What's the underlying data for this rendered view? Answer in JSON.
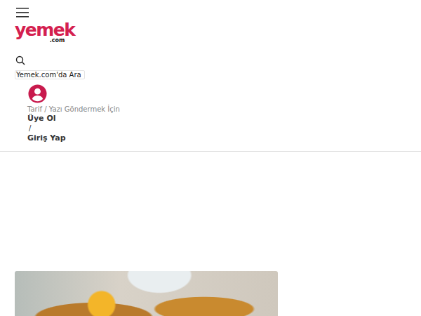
{
  "logo": {
    "name": "yemek",
    "domain": ".com"
  },
  "search": {
    "placeholder": "Yemek.com'da Ara"
  },
  "account": {
    "caption": "Tarif / Yazı Göndermek İçin",
    "register": "Üye Ol",
    "separator": "/",
    "login": "Giriş Yap"
  }
}
